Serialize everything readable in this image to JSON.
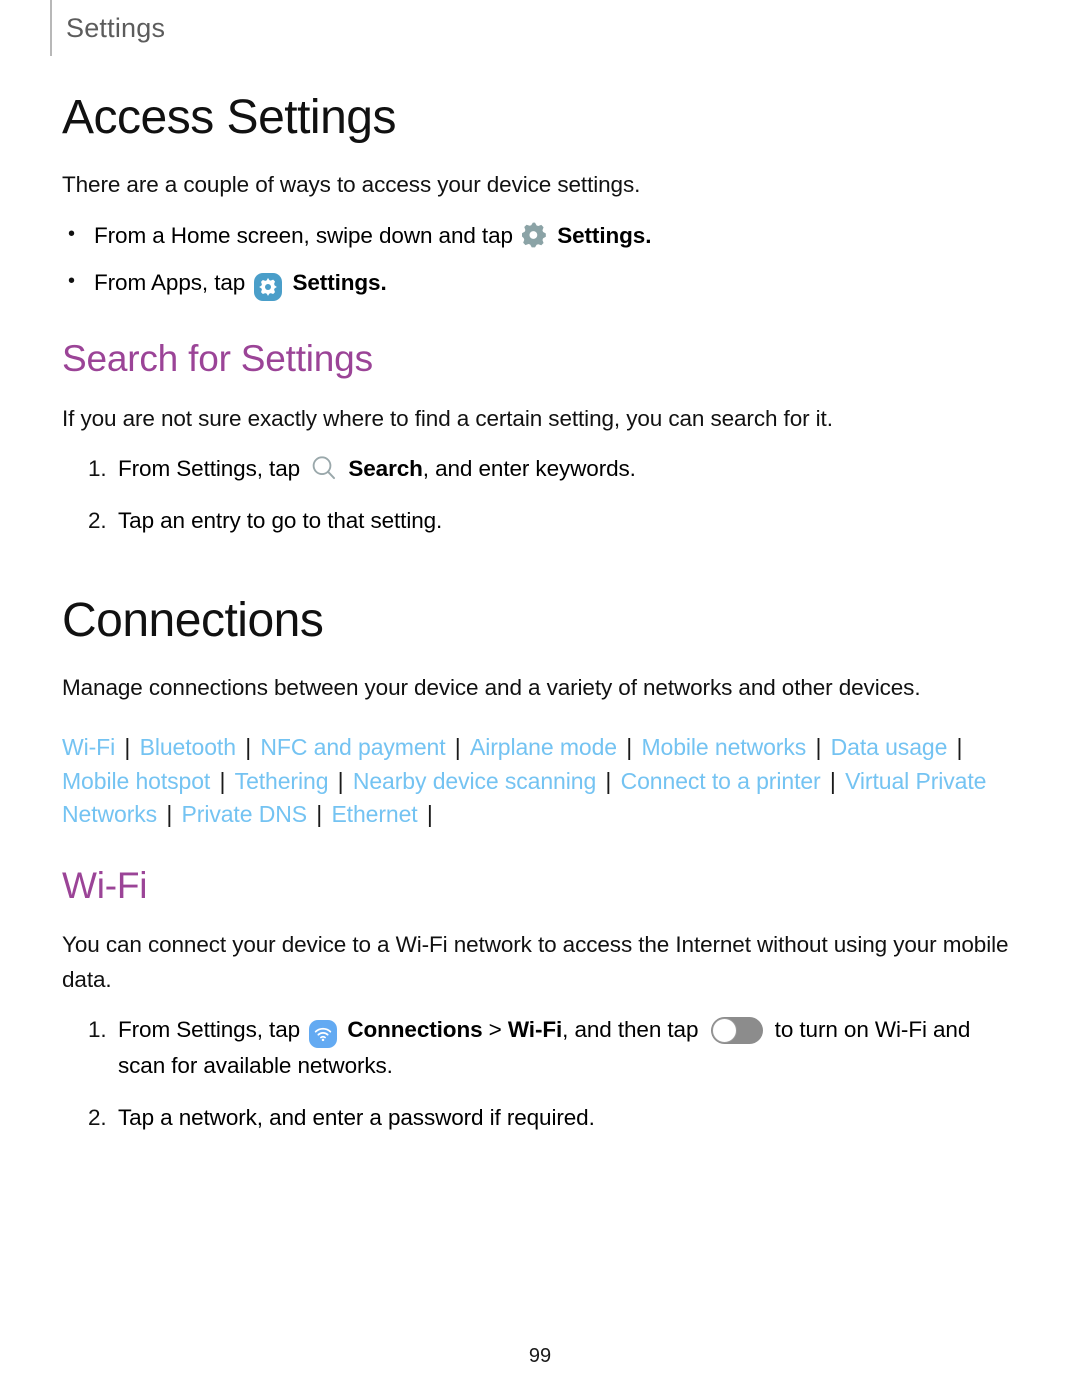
{
  "header": {
    "label": "Settings"
  },
  "access_settings": {
    "title": "Access Settings",
    "intro": "There are a couple of ways to access your device settings.",
    "bullets": [
      {
        "before": "From a Home screen, swipe down and tap",
        "icon": "gear-icon",
        "bold": "Settings",
        "after": "."
      },
      {
        "before": "From Apps, tap",
        "icon": "settings-app-icon",
        "bold": "Settings",
        "after": "."
      }
    ]
  },
  "search_for_settings": {
    "title": "Search for Settings",
    "intro": "If you are not sure exactly where to find a certain setting, you can search for it.",
    "steps": [
      {
        "before": "From Settings, tap",
        "icon": "search-icon",
        "bold": "Search",
        "after": ", and enter keywords."
      },
      {
        "before": "Tap an entry to go to that setting.",
        "icon": "",
        "bold": "",
        "after": ""
      }
    ]
  },
  "connections": {
    "title": "Connections",
    "intro": "Manage connections between your device and a variety of networks and other devices.",
    "links": [
      "Wi-Fi",
      "Bluetooth",
      "NFC and payment",
      "Airplane mode",
      "Mobile networks",
      "Data usage",
      "Mobile hotspot",
      "Tethering",
      "Nearby device scanning",
      "Connect to a printer",
      "Virtual Private Networks",
      "Private DNS",
      "Ethernet"
    ],
    "link_separator": "|"
  },
  "wifi": {
    "title": "Wi-Fi",
    "intro": "You can connect your device to a Wi-Fi network to access the Internet without using your mobile data.",
    "step1": {
      "part1": "From Settings, tap",
      "icon1": "connections-app-icon",
      "bold1": "Connections",
      "chevron": ">",
      "bold2": "Wi-Fi",
      "part2": ", and then tap",
      "toggle": "wifi-toggle-off",
      "part3": "to turn on Wi-Fi and scan for available networks."
    },
    "step2": "Tap a network, and enter a password if required."
  },
  "footer": {
    "page_number": "99"
  },
  "colors": {
    "heading_accent": "#9b4497",
    "link": "#74c3f2",
    "app_icon_blue": "#4a9ec9",
    "wifi_icon_blue": "#63aaf2",
    "gear_gray": "#8ba3a6",
    "rule_gray": "#b8b8b8"
  }
}
